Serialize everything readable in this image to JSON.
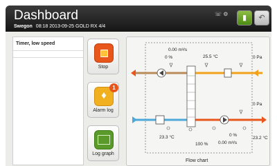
{
  "header": {
    "title": "Dashboard",
    "brand": "Swegon",
    "subline": "08:18 2013-09-25  GOLD RX  4/4",
    "status_icons": "☏ ⚙"
  },
  "left_panel": {
    "status": "Timer, low speed"
  },
  "buttons": {
    "stop": {
      "label": "Stop"
    },
    "alarm": {
      "label": "Alarm log",
      "badge": "1"
    },
    "graph": {
      "label": "Log graph"
    }
  },
  "flow": {
    "title": "Flow chart",
    "values": {
      "top_flow": "0.00 m³/s",
      "top_pct": "0 %",
      "top_temp": "25.5 °C",
      "top_pa": "0 Pa",
      "right_pa": "0 Pa",
      "bottom_temp_left": "23.3 °C",
      "bottom_pct": "0 %",
      "bottom_flow": "0.00 m³/s",
      "bottom_pct_center": "100 %",
      "bottom_temp_right": "23.2 °C"
    },
    "colors": {
      "extract_warm": "#f2a21a",
      "extract_left": "#b98a5a",
      "supply_cool": "#4ba8d8",
      "supply_warm": "#e8561c"
    }
  }
}
